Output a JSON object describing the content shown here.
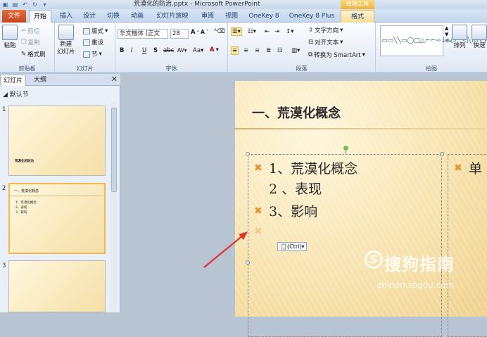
{
  "window": {
    "title": "荒漠化的防治.pptx - Microsoft PowerPoint",
    "context_group": "绘图工具"
  },
  "tabs": [
    "文件",
    "开始",
    "插入",
    "设计",
    "切换",
    "动画",
    "幻灯片放映",
    "审阅",
    "视图",
    "OneKey 8",
    "OneKey 8 Plus",
    "格式"
  ],
  "ribbon": {
    "clipboard": {
      "label": "剪贴板",
      "paste": "粘贴",
      "cut": "剪切",
      "copy": "复制",
      "format_painter": "格式刷"
    },
    "slides": {
      "label": "幻灯片",
      "new_slide": "新建\n幻灯片",
      "layout": "版式",
      "reset": "重设",
      "section": "节"
    },
    "font": {
      "label": "字体",
      "font_name": "华文楷体 (正文",
      "font_size": "28"
    },
    "paragraph": {
      "label": "段落",
      "text_direction": "文字方向",
      "align_text": "对齐文本",
      "smartart": "转换为 SmartArt"
    },
    "drawing": {
      "label": "绘图",
      "arrange": "排列",
      "quick_styles": "快速"
    }
  },
  "pane": {
    "tabs": [
      "幻灯片",
      "大纲"
    ],
    "section_name": "默认节",
    "thumbs": [
      {
        "num": "1",
        "text": "荒漠化的防治"
      },
      {
        "num": "2",
        "title": "一、荒漠化概念",
        "lines": [
          "1、荒漠化概念",
          "2、表现",
          "3、影响"
        ]
      },
      {
        "num": "3"
      }
    ]
  },
  "slide": {
    "title": "一、荒漠化概念",
    "lines": [
      "1、荒漠化概念",
      "2 、表现",
      "3、影响"
    ],
    "right_text": "单",
    "paste_options": "(Ctrl)"
  },
  "watermark": {
    "text": "搜狗指南",
    "sub": "zhinan.sogou.com",
    "logo": "S"
  },
  "colors": {
    "accent_orange": "#e8952c",
    "file_tab": "#c5431a",
    "selection": "#f2b84b"
  }
}
